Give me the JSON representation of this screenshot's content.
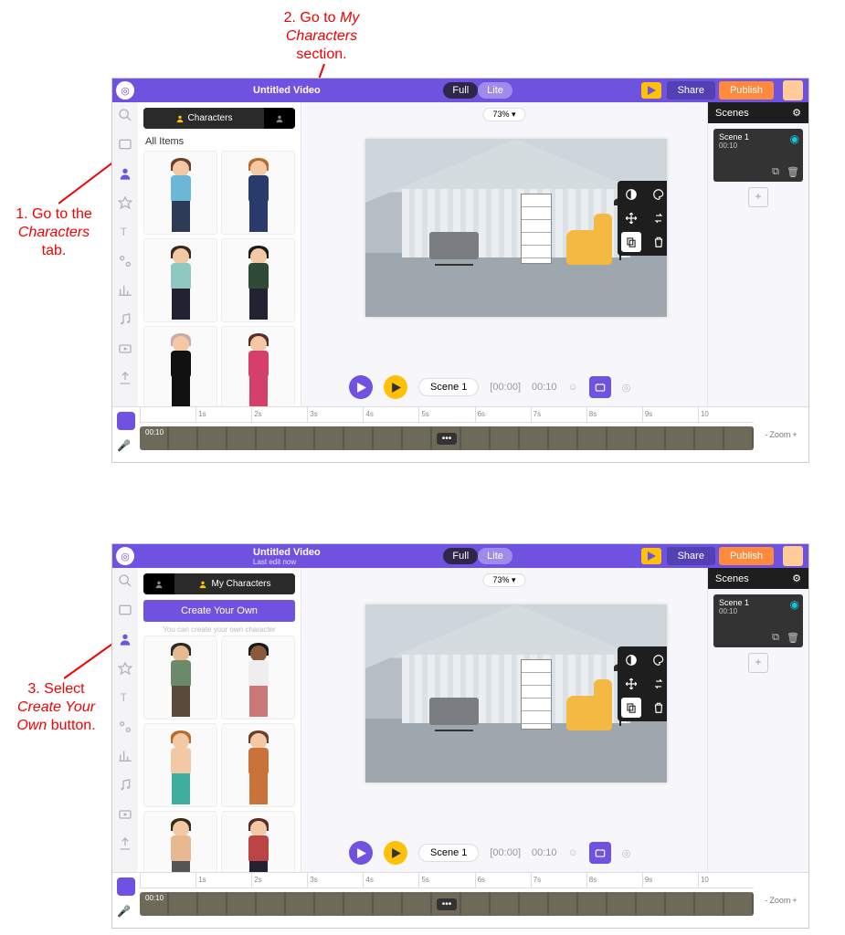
{
  "annotations": {
    "a1_l1": "1. Go to the",
    "a1_l2": "Characters",
    "a1_l3": "tab.",
    "a2_l1": "2. Go to ",
    "a2_l2": "My",
    "a2_l3": "Characters",
    "a2_l4": "section.",
    "a3_l1": "3. Select",
    "a3_l2": "Create Your",
    "a3_l3": "Own",
    "a3_l4": " button."
  },
  "header": {
    "title": "Untitled Video",
    "subtitle": "Last edit now",
    "pill_full": "Full",
    "pill_lite": "Lite",
    "share": "Share",
    "publish": "Publish"
  },
  "panel1": {
    "tab_characters": "Characters",
    "section": "All Items"
  },
  "panel2": {
    "tab_my_characters": "My Characters",
    "create_your_own": "Create Your Own",
    "hint": "You can create your own character"
  },
  "canvas": {
    "zoom": "73%",
    "scene_chip": "Scene 1",
    "time_start": "[00:00]",
    "time_end": "00:10"
  },
  "scenes": {
    "header": "Scenes",
    "thumb_title": "Scene 1",
    "thumb_time": "00:10",
    "add": "+"
  },
  "timeline": {
    "ticks": [
      "",
      "1s",
      "2s",
      "3s",
      "4s",
      "5s",
      "6s",
      "7s",
      "8s",
      "9s",
      "10"
    ],
    "track_label": "00:10",
    "dots": "•••",
    "zoom_minus": "-",
    "zoom_label": "Zoom",
    "zoom_plus": "+"
  },
  "chars1": [
    {
      "hair": "#6b3f28",
      "skin": "#f2c9a4",
      "top": "#6ab7d6",
      "bottom": "#2e3b56"
    },
    {
      "hair": "#b96b2e",
      "skin": "#f2c9a4",
      "top": "#283b6b",
      "bottom": "#283b6b"
    },
    {
      "hair": "#3a2a1b",
      "skin": "#f2c9a4",
      "top": "#8fc7c1",
      "bottom": "#223"
    },
    {
      "hair": "#1a1a1a",
      "skin": "#f2c9a4",
      "top": "#2f4a36",
      "bottom": "#223"
    },
    {
      "hair": "#caa",
      "skin": "#f2c9a4",
      "top": "#111",
      "bottom": "#111"
    },
    {
      "hair": "#5a2b2b",
      "skin": "#f2c9a4",
      "top": "#d43f6b",
      "bottom": "#d43f6b"
    }
  ],
  "chars2": [
    {
      "hair": "#2a2a2a",
      "skin": "#e8b990",
      "top": "#6a8a6a",
      "bottom": "#5a4a3a"
    },
    {
      "hair": "#1a1a1a",
      "skin": "#8a5a3a",
      "top": "#eee",
      "bottom": "#c77"
    },
    {
      "hair": "#b96b2e",
      "skin": "#f2c9a4",
      "top": "#f2c9a4",
      "bottom": "#3fae9e"
    },
    {
      "hair": "#6b3f28",
      "skin": "#f2c9a4",
      "top": "#c9733a",
      "bottom": "#c9733a"
    },
    {
      "hair": "#3a2a1b",
      "skin": "#f2c9a4",
      "top": "#e8b990",
      "bottom": "#555"
    },
    {
      "hair": "#5a2b2b",
      "skin": "#f2c9a4",
      "top": "#b44",
      "bottom": "#223"
    }
  ]
}
